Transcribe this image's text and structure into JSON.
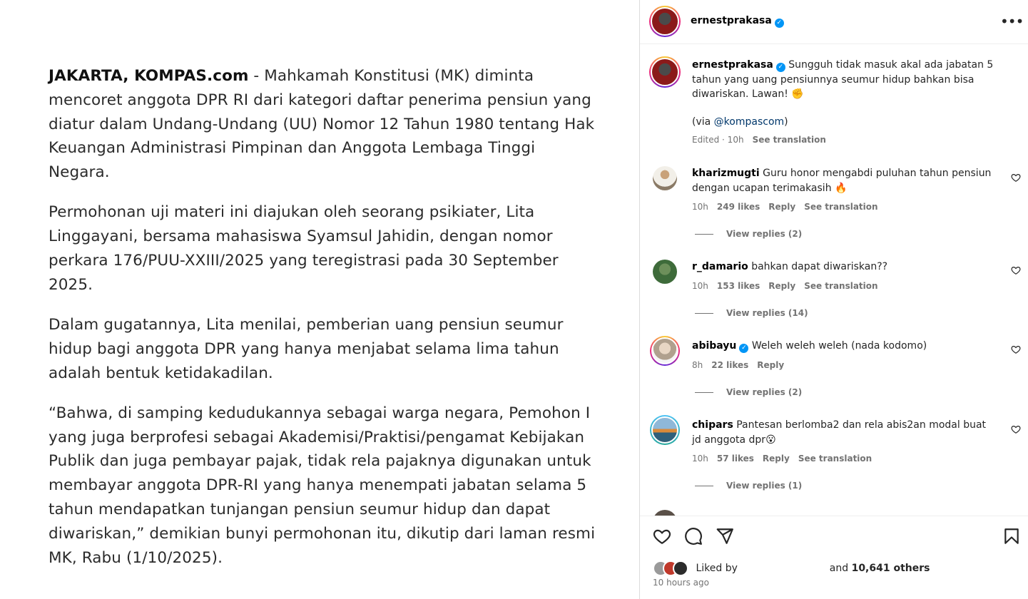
{
  "article": {
    "dateline": "JAKARTA, KOMPAS.com",
    "p1_rest": " - Mahkamah Konstitusi (MK) diminta mencoret anggota DPR RI dari kategori daftar penerima pensiun yang diatur dalam Undang-Undang (UU) Nomor 12 Tahun 1980 tentang Hak Keuangan Administrasi Pimpinan dan Anggota Lembaga Tinggi Negara.",
    "p2": "Permohonan uji materi ini diajukan oleh seorang psikiater, Lita Linggayani, bersama mahasiswa Syamsul Jahidin, dengan nomor perkara 176/PUU-XXIII/2025 yang teregistrasi pada 30 September 2025.",
    "p3": "Dalam gugatannya, Lita menilai, pemberian uang pensiun seumur hidup bagi anggota DPR yang hanya menjabat selama lima tahun adalah bentuk ketidakadilan.",
    "p4": "“Bahwa, di samping kedudukannya sebagai warga negara, Pemohon I yang juga berprofesi sebagai Akademisi/Praktisi/pengamat Kebijakan Publik dan juga pembayar pajak, tidak rela pajaknya digunakan untuk membayar anggota DPR-RI yang hanya menempati jabatan selama 5 tahun mendapatkan tunjangan pensiun seumur hidup dan dapat diwariskan,” demikian bunyi permohonan itu, dikutip dari laman resmi MK, Rabu (1/10/2025)."
  },
  "header": {
    "username": "ernestprakasa",
    "verified_glyph": "✓",
    "more_glyph": "•••"
  },
  "caption": {
    "username": "ernestprakasa",
    "text": "Sungguh tidak masuk akal ada jabatan 5 tahun yang uang pensiunnya seumur hidup bahkan bisa diwariskan. Lawan! ✊",
    "via_prefix": "(via ",
    "mention": "@kompascom",
    "via_suffix": ")",
    "edited": "Edited · 10h",
    "see_translation": "See translation"
  },
  "comments": [
    {
      "username": "kharizmugti",
      "verified": false,
      "text": "Guru honor mengabdi puluhan tahun pensiun dengan ucapan terimakasih 🔥",
      "time": "10h",
      "likes": "249 likes",
      "reply": "Reply",
      "see_translation": "See translation",
      "view_replies": "View replies (2)"
    },
    {
      "username": "r_damario",
      "verified": false,
      "text": "bahkan dapat diwariskan??",
      "time": "10h",
      "likes": "153 likes",
      "reply": "Reply",
      "see_translation": "See translation",
      "view_replies": "View replies (14)"
    },
    {
      "username": "abibayu",
      "verified": true,
      "text": "Weleh weleh weleh (nada kodomo)",
      "time": "8h",
      "likes": "22 likes",
      "reply": "Reply",
      "see_translation": "",
      "view_replies": "View replies (2)"
    },
    {
      "username": "chipars",
      "verified": false,
      "text": "Pantesan berlomba2 dan rela abis2an modal buat jd anggota dpr😮",
      "time": "10h",
      "likes": "57 likes",
      "reply": "Reply",
      "see_translation": "See translation",
      "view_replies": "View replies (1)"
    }
  ],
  "footer": {
    "liked_by": "Liked by",
    "and_text": "and",
    "others": "10,641 others",
    "timestamp": "10 hours ago"
  },
  "colors": {
    "verified": "#0095f6",
    "secondary_text": "#737373",
    "mention": "#00376b"
  }
}
